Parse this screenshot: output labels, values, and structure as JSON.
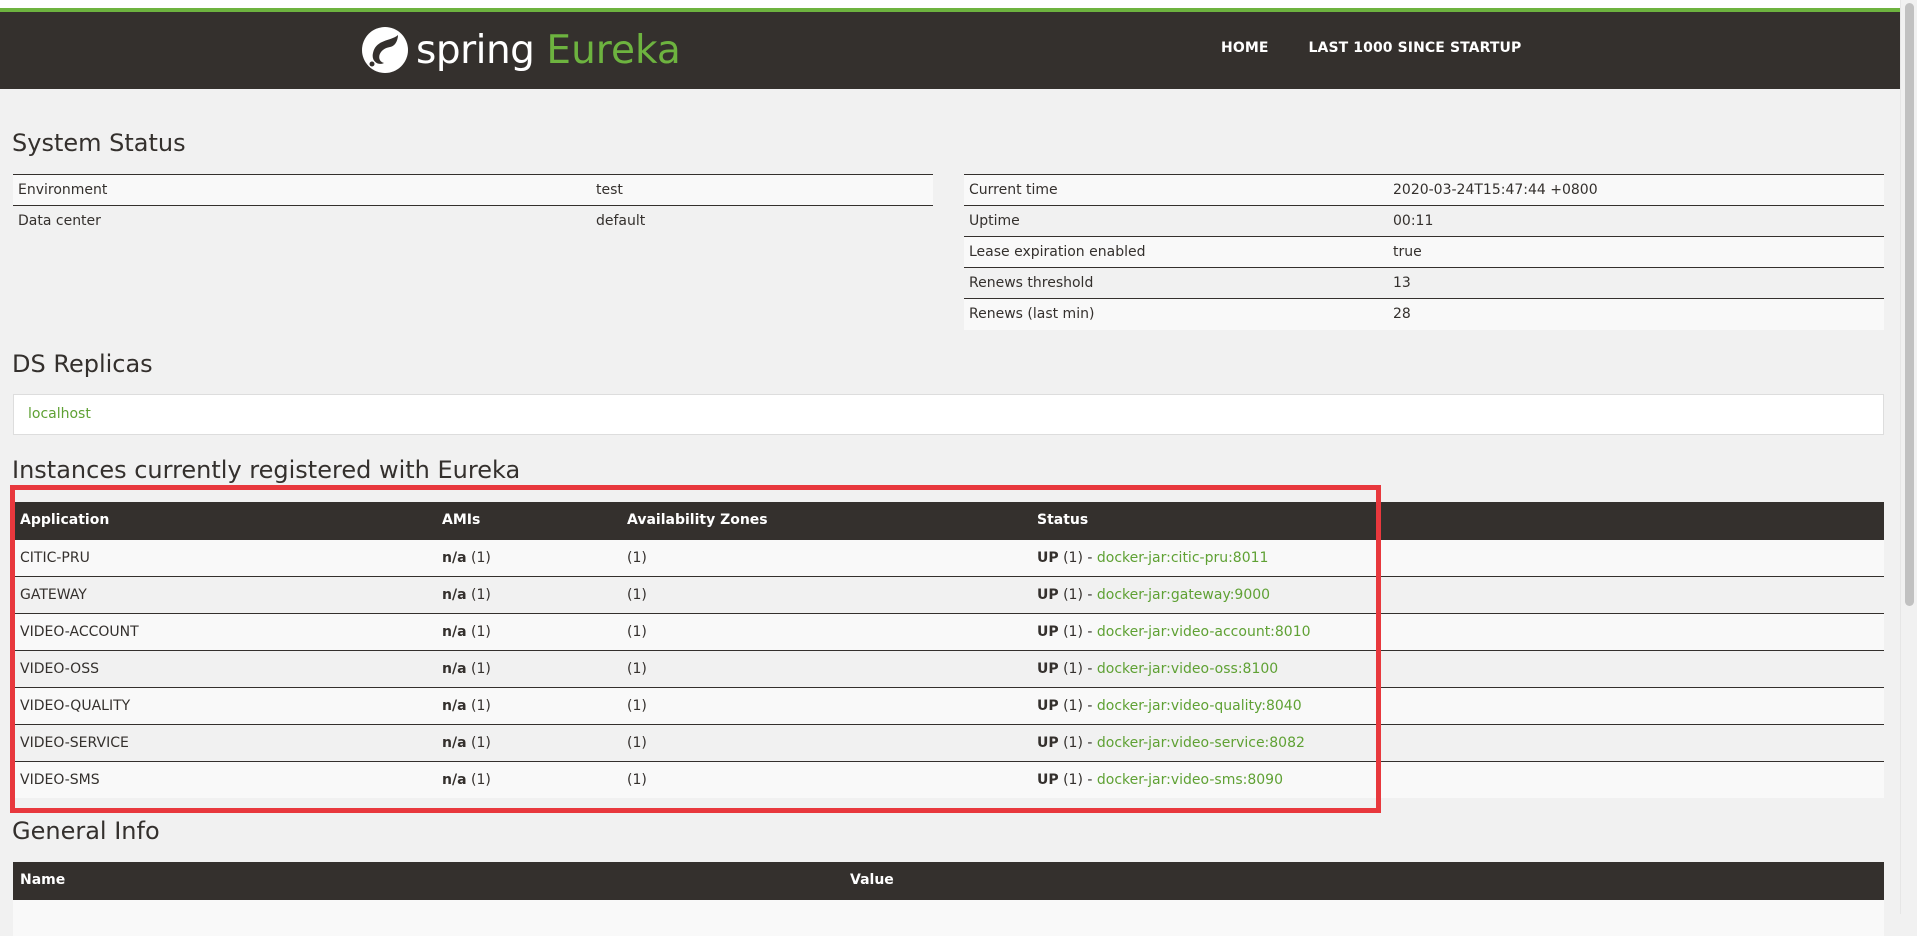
{
  "header": {
    "brand_spring": "spring",
    "brand_eureka": "Eureka",
    "nav": [
      "HOME",
      "LAST 1000 SINCE STARTUP"
    ]
  },
  "system_status": {
    "title": "System Status",
    "left": [
      {
        "name": "Environment",
        "value": "test"
      },
      {
        "name": "Data center",
        "value": "default"
      }
    ],
    "right": [
      {
        "name": "Current time",
        "value": "2020-03-24T15:47:44 +0800"
      },
      {
        "name": "Uptime",
        "value": "00:11"
      },
      {
        "name": "Lease expiration enabled",
        "value": "true"
      },
      {
        "name": "Renews threshold",
        "value": "13"
      },
      {
        "name": "Renews (last min)",
        "value": "28"
      }
    ]
  },
  "ds_replicas": {
    "title": "DS Replicas",
    "items": [
      "localhost"
    ]
  },
  "instances": {
    "title": "Instances currently registered with Eureka",
    "columns": [
      "Application",
      "AMIs",
      "Availability Zones",
      "Status"
    ],
    "rows": [
      {
        "app": "CITIC-PRU",
        "ami": "n/a",
        "ami_count": " (1)",
        "zones": "(1)",
        "status": "UP",
        "status_count": " (1) - ",
        "link": "docker-jar:citic-pru:8011"
      },
      {
        "app": "GATEWAY",
        "ami": "n/a",
        "ami_count": " (1)",
        "zones": "(1)",
        "status": "UP",
        "status_count": " (1) - ",
        "link": "docker-jar:gateway:9000"
      },
      {
        "app": "VIDEO-ACCOUNT",
        "ami": "n/a",
        "ami_count": " (1)",
        "zones": "(1)",
        "status": "UP",
        "status_count": " (1) - ",
        "link": "docker-jar:video-account:8010"
      },
      {
        "app": "VIDEO-OSS",
        "ami": "n/a",
        "ami_count": " (1)",
        "zones": "(1)",
        "status": "UP",
        "status_count": " (1) - ",
        "link": "docker-jar:video-oss:8100"
      },
      {
        "app": "VIDEO-QUALITY",
        "ami": "n/a",
        "ami_count": " (1)",
        "zones": "(1)",
        "status": "UP",
        "status_count": " (1) - ",
        "link": "docker-jar:video-quality:8040"
      },
      {
        "app": "VIDEO-SERVICE",
        "ami": "n/a",
        "ami_count": " (1)",
        "zones": "(1)",
        "status": "UP",
        "status_count": " (1) - ",
        "link": "docker-jar:video-service:8082"
      },
      {
        "app": "VIDEO-SMS",
        "ami": "n/a",
        "ami_count": " (1)",
        "zones": "(1)",
        "status": "UP",
        "status_count": " (1) - ",
        "link": "docker-jar:video-sms:8090"
      }
    ]
  },
  "general_info": {
    "title": "General Info",
    "columns": [
      "Name",
      "Value"
    ]
  },
  "colors": {
    "header_bg": "#34302d",
    "accent_green": "#6db33f",
    "highlight_red": "#e8383d"
  }
}
